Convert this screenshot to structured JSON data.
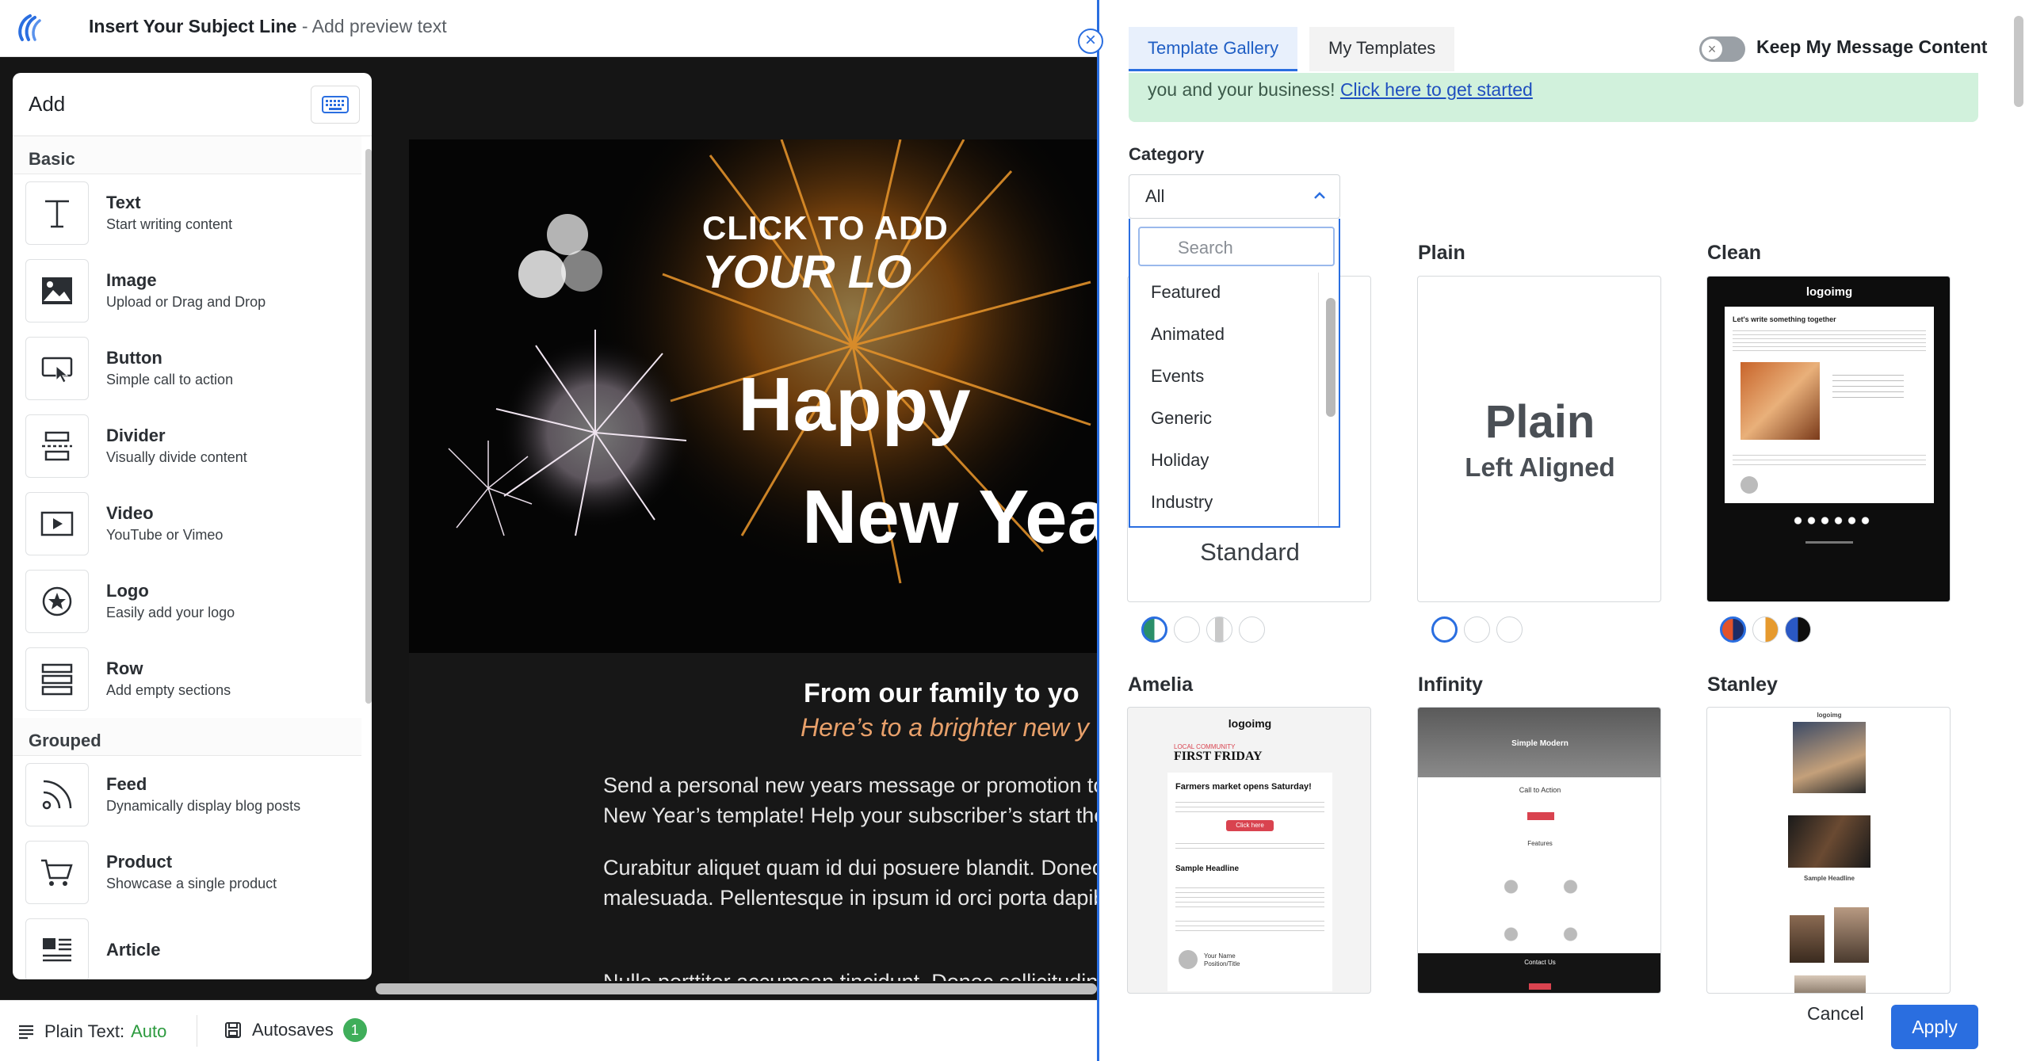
{
  "header": {
    "subject_line": "Insert Your Subject Line",
    "preview_text": "- Add preview text"
  },
  "add_panel": {
    "title": "Add",
    "sections": [
      {
        "label": "Basic",
        "items": [
          {
            "name": "Text",
            "desc": "Start writing content",
            "icon": "text-icon"
          },
          {
            "name": "Image",
            "desc": "Upload or Drag and Drop",
            "icon": "image-icon"
          },
          {
            "name": "Button",
            "desc": "Simple call to action",
            "icon": "button-icon"
          },
          {
            "name": "Divider",
            "desc": "Visually divide content",
            "icon": "divider-icon"
          },
          {
            "name": "Video",
            "desc": "YouTube or Vimeo",
            "icon": "video-icon"
          },
          {
            "name": "Logo",
            "desc": "Easily add your logo",
            "icon": "logo-icon"
          },
          {
            "name": "Row",
            "desc": "Add empty sections",
            "icon": "row-icon"
          }
        ]
      },
      {
        "label": "Grouped",
        "items": [
          {
            "name": "Feed",
            "desc": "Dynamically display blog posts",
            "icon": "feed-icon"
          },
          {
            "name": "Product",
            "desc": "Showcase a single product",
            "icon": "cart-icon"
          },
          {
            "name": "Article",
            "desc": "",
            "icon": "article-icon"
          }
        ]
      }
    ]
  },
  "preview": {
    "logo_line1": "CLICK TO ADD",
    "logo_line2": "YOUR LO",
    "heading1": "Happy",
    "heading2": "New Yea",
    "subheading": "From our family to yo",
    "subheading_italic": "Here’s to a brighter new y",
    "para1_line1": "Send a personal new years message or promotion to",
    "para1_line2": "New Year’s template! Help your subscriber’s start the",
    "para2_line1": "Curabitur aliquet quam id dui posuere blandit. Donec",
    "para2_line2": "malesuada. Pellentesque in ipsum id orci porta dapib",
    "para3_line1": "Nulla porttitor accumsan tincidunt. Donec sollicitudin"
  },
  "bottom_bar": {
    "plain_text_label": "Plain Text:",
    "plain_text_value": "Auto",
    "autosaves_label": "Autosaves",
    "autosaves_count": "1"
  },
  "gallery": {
    "tabs": [
      "Template Gallery",
      "My Templates"
    ],
    "keep_content_label": "Keep My Message Content",
    "banner_text": "you and your business!",
    "banner_link": "Click here to get started",
    "category_label": "Category",
    "category_value": "All",
    "search_placeholder": "Search",
    "category_options": [
      "Featured",
      "Animated",
      "Events",
      "Generic",
      "Holiday",
      "Industry"
    ],
    "templates": [
      {
        "name": "",
        "caption": "Standard"
      },
      {
        "name": "Plain",
        "line1": "Plain",
        "line2": "Left Aligned"
      },
      {
        "name": "Clean",
        "logo": "logoimg",
        "heading": "Let's write something together"
      },
      {
        "name": "Amelia",
        "logo": "logoimg",
        "kicker": "LOCAL COMMUNITY",
        "title": "FIRST FRIDAY",
        "headline": "Farmers market opens Saturday!",
        "sample": "Sample Headline",
        "btn": "Click here",
        "sig1": "Your Name",
        "sig2": "Position/Title"
      },
      {
        "name": "Infinity",
        "title": "Simple Modern",
        "cta": "Call to Action",
        "features": "Features",
        "contact": "Contact Us"
      },
      {
        "name": "Stanley",
        "logo": "logoimg",
        "headline": "Sample Headline"
      }
    ],
    "cancel_label": "Cancel",
    "apply_label": "Apply",
    "accent": "#2a6ee0"
  }
}
